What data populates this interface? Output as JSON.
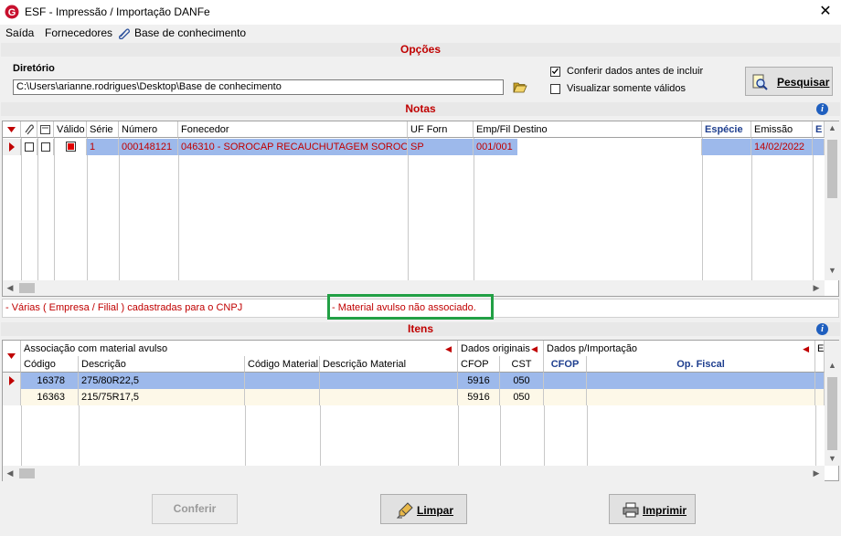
{
  "window": {
    "title": "ESF - Impressão / Importação DANFe",
    "close": "✕"
  },
  "menu": [
    {
      "label": "Saída"
    },
    {
      "label": "Fornecedores"
    },
    {
      "label": "Base de conhecimento"
    }
  ],
  "opcoes": {
    "section_title": "Opções",
    "diretorio_label": "Diretório",
    "diretorio_value": "C:\\Users\\arianne.rodrigues\\Desktop\\Base de conhecimento",
    "conferir_label": "Conferir dados antes de incluir",
    "conferir_checked": true,
    "visualizar_label": "Visualizar somente válidos",
    "visualizar_checked": false,
    "pesquisar_label": "Pesquisar"
  },
  "notas": {
    "section_title": "Notas",
    "columns": [
      "Válido",
      "Série",
      "Número",
      "Fonecedor",
      "UF Forn",
      "Emp/Fil Destino",
      "Espécie",
      "Emissão",
      "E"
    ],
    "rows": [
      {
        "serie": "1",
        "numero": "000148121",
        "fornecedor": "046310 - SOROCAP RECAUCHUTAGEM SOROC...",
        "uf": "SP",
        "emp_fil": "001/001",
        "especie": "",
        "emissao": "14/02/2022"
      }
    ]
  },
  "messages": {
    "left": "- Várias ( Empresa / Filial ) cadastradas para o CNPJ",
    "right": "- Material avulso não associado."
  },
  "itens": {
    "section_title": "Itens",
    "groups": [
      "Associação com material avulso",
      "Dados originais",
      "Dados p/Importação",
      "E"
    ],
    "columns": [
      "Código",
      "Descrição",
      "Código Material",
      "Descrição Material",
      "CFOP",
      "CST",
      "CFOP",
      "Op. Fiscal"
    ],
    "rows": [
      {
        "codigo": "16378",
        "descricao": "275/80R22,5",
        "cod_material": "",
        "desc_material": "",
        "cfop": "5916",
        "cst": "050",
        "cfop2": "",
        "op_fiscal": ""
      },
      {
        "codigo": "16363",
        "descricao": "215/75R17,5",
        "cod_material": "",
        "desc_material": "",
        "cfop": "5916",
        "cst": "050",
        "cfop2": "",
        "op_fiscal": ""
      }
    ]
  },
  "buttons": {
    "conferir": "Conferir",
    "limpar": "Limpar",
    "imprimir": "Imprimir"
  },
  "colors": {
    "selected_row": "#9db9eb",
    "highlight_box": "#22a045",
    "red_text": "#c00000"
  }
}
